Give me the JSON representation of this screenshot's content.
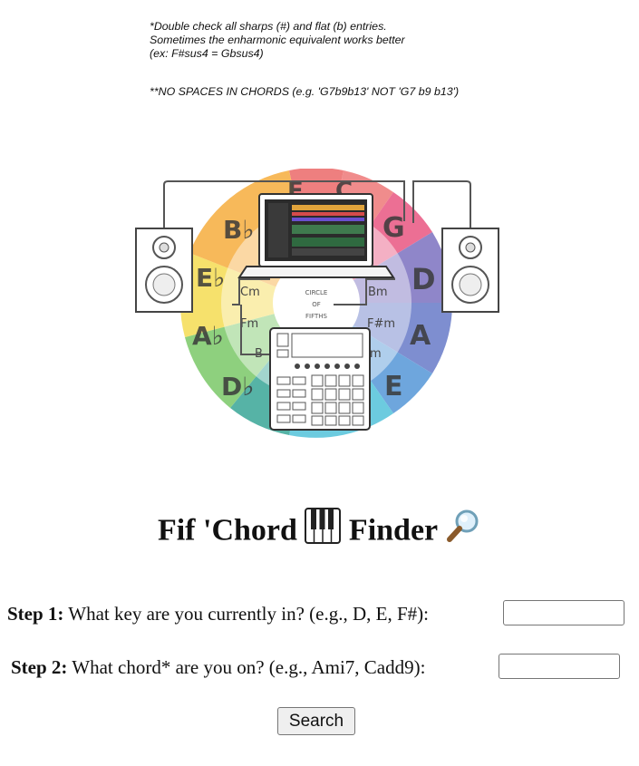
{
  "notes": {
    "line1": "*Double check all sharps (#) and flat (b) entries.",
    "line2": "Sometimes the enharmonic equivalent works better",
    "line3": "(ex: F#sus4 = Gbsus4)",
    "line4": "**NO SPACES IN CHORDS (e.g. 'G7b9b13' NOT 'G7 b9 b13')"
  },
  "hero_image": {
    "circle_center_text": [
      "CIRCLE",
      "OF",
      "FIFTHS"
    ],
    "outer_keys": [
      "F",
      "C",
      "G",
      "D",
      "A",
      "E",
      "D♭",
      "A♭",
      "E♭",
      "B♭"
    ],
    "inner_keys": [
      "Cm",
      "Bm",
      "F#m",
      "Fm",
      "Bm",
      "m",
      "Em"
    ],
    "colors": {
      "red": "#ee7f7f",
      "pink": "#ec6f94",
      "purple": "#8f86c9",
      "blue_purple": "#7e8ed0",
      "blue": "#6ea6dd",
      "cyan": "#6ccbdf",
      "teal": "#56b3a6",
      "green": "#8ed07e",
      "yellow": "#f6e16c",
      "orange": "#f7b95a"
    }
  },
  "title": {
    "text1": "Fif 'Chord",
    "emoji1": "🎹",
    "text2": "Finder",
    "emoji2": "🔎"
  },
  "form": {
    "step1_label": "Step 1:",
    "step1_text": " What key are you currently in? (e.g., D, E, F#):",
    "step1_value": "",
    "step2_label": "Step 2:",
    "step2_text": " What chord* are you on? (e.g., Ami7, Cadd9):",
    "step2_value": "",
    "search_label": "Search"
  }
}
